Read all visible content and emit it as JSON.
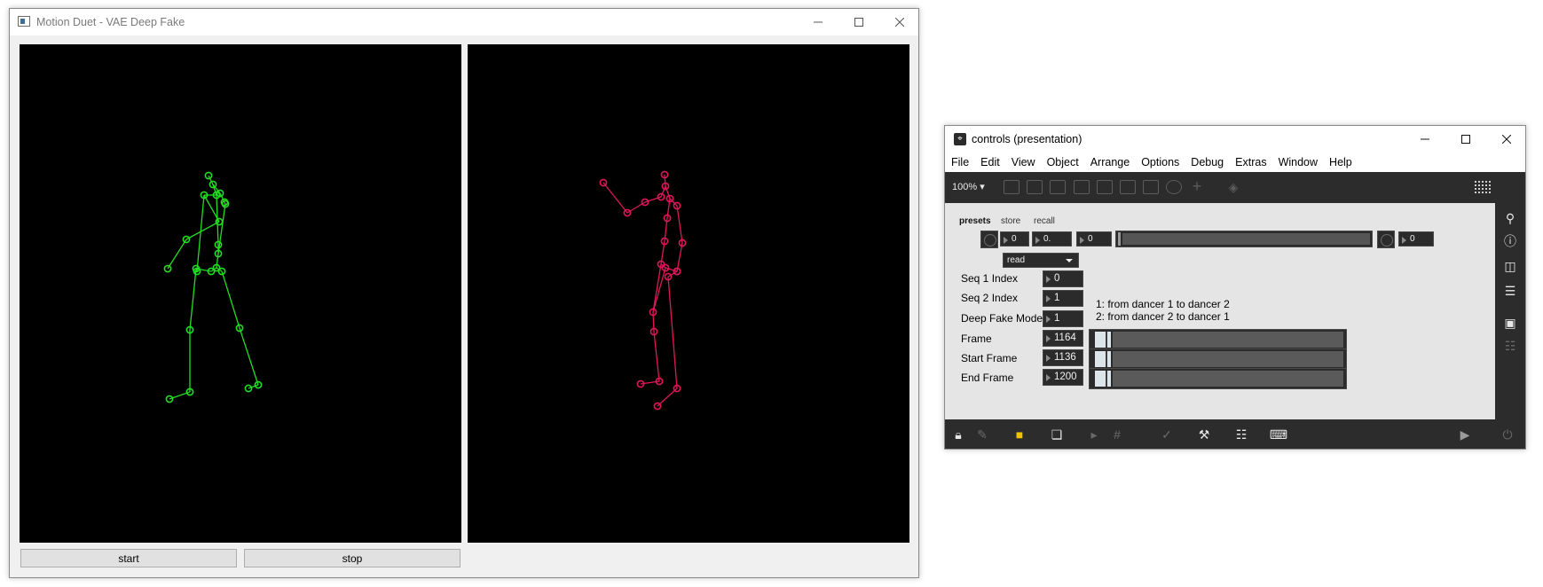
{
  "motion_window": {
    "title": "Motion Duet - VAE Deep Fake",
    "start_label": "start",
    "stop_label": "stop",
    "dancer_color_left": "#22dd22",
    "dancer_color_right": "#e0165c"
  },
  "controls_window": {
    "title": "controls (presentation)",
    "menu": [
      "File",
      "Edit",
      "View",
      "Object",
      "Arrange",
      "Options",
      "Debug",
      "Extras",
      "Window",
      "Help"
    ],
    "zoom": "100%",
    "presets": {
      "title": "presets",
      "store": "store",
      "recall": "recall",
      "store_value": "0",
      "recall_value": "0.",
      "slot_value": "0",
      "slider_value": 0,
      "output_value": "0",
      "menu_value": "read"
    },
    "seq1": {
      "label": "Seq 1 Index",
      "value": "0"
    },
    "seq2": {
      "label": "Seq 2 Index",
      "value": "1"
    },
    "mode": {
      "label": "Deep Fake Mode",
      "value": "1"
    },
    "mode_help_1": "1: from dancer 1 to dancer 2",
    "mode_help_2": "2: from dancer 2 to dancer 1",
    "frame": {
      "label": "Frame",
      "value": "1164"
    },
    "start_frame": {
      "label": "Start Frame",
      "value": "1136"
    },
    "end_frame": {
      "label": "End Frame",
      "value": "1200"
    }
  }
}
